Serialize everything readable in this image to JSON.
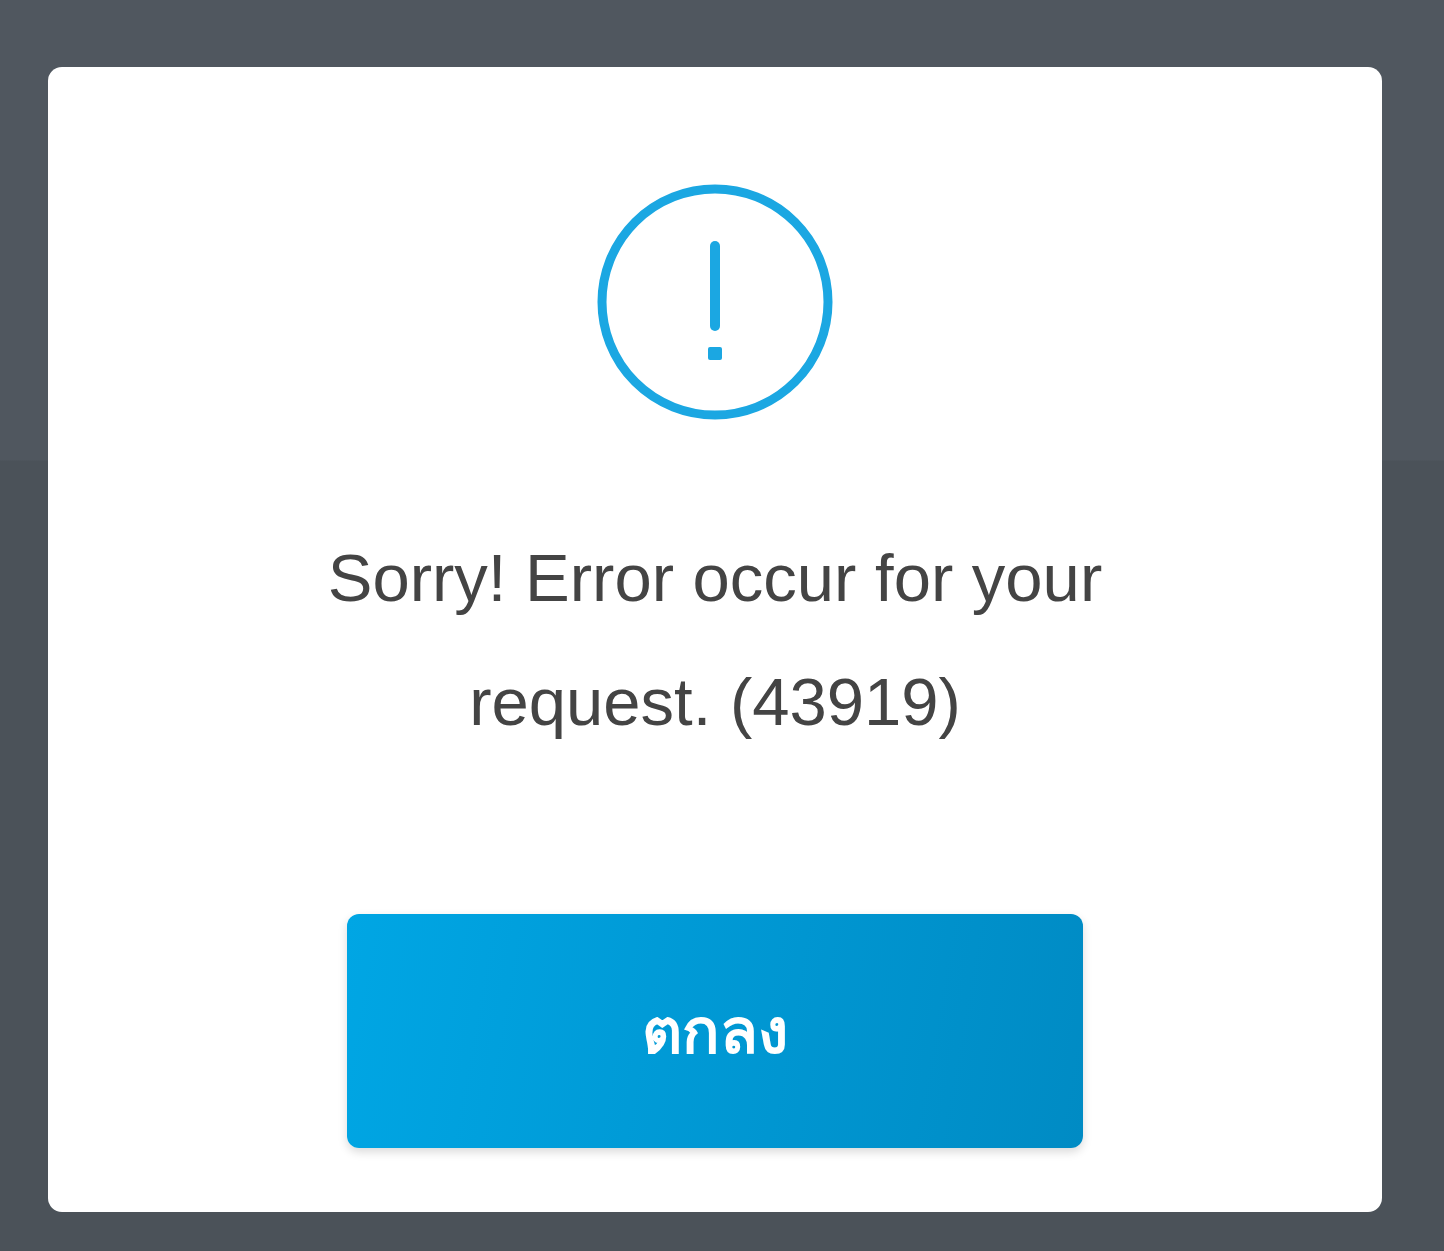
{
  "dialog": {
    "kind": "error",
    "message": "Sorry! Error occur for your request. (43919)",
    "button": "ตกลง"
  }
}
